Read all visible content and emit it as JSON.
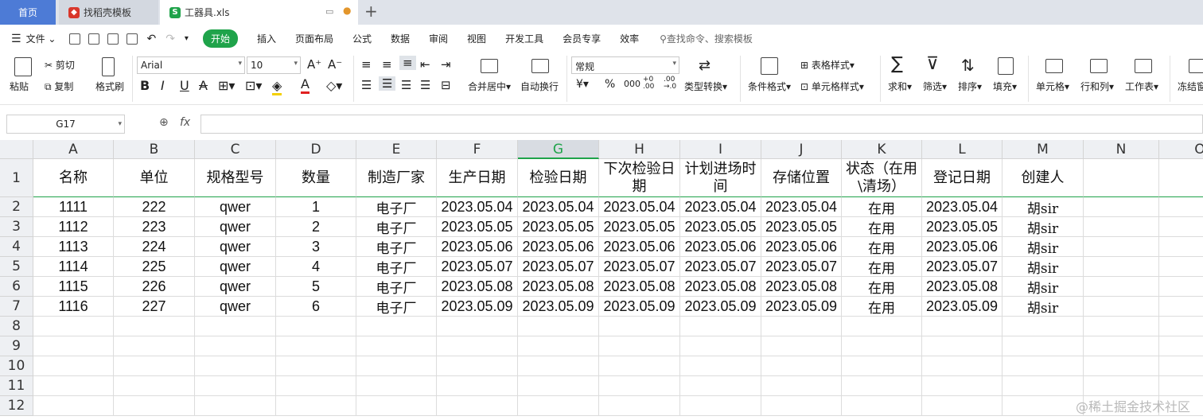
{
  "tabs": {
    "home": "首页",
    "template": "找稻壳模板",
    "file": "工器具.xls"
  },
  "menu": {
    "file": "文件",
    "items": [
      "开始",
      "插入",
      "页面布局",
      "公式",
      "数据",
      "审阅",
      "视图",
      "开发工具",
      "会员专享",
      "效率"
    ],
    "search": "查找命令、搜索模板"
  },
  "ribbon": {
    "paste": "粘贴",
    "cut": "剪切",
    "copy": "复制",
    "format_painter": "格式刷",
    "font_name": "Arial",
    "font_size": "10",
    "merge_center": "合并居中",
    "wrap": "自动换行",
    "number_format": "常规",
    "type_convert": "类型转换",
    "cond_format": "条件格式",
    "table_style": "表格样式",
    "cell_style": "单元格样式",
    "sum": "求和",
    "filter": "筛选",
    "sort": "排序",
    "fill": "填充",
    "cell": "单元格",
    "row_col": "行和列",
    "worksheet": "工作表",
    "freeze": "冻结窗"
  },
  "formula_bar": {
    "name_box": "G17",
    "fx": "fx",
    "value": ""
  },
  "sheet": {
    "columns": [
      "A",
      "B",
      "C",
      "D",
      "E",
      "F",
      "G",
      "H",
      "I",
      "J",
      "K",
      "L",
      "M",
      "N",
      "O"
    ],
    "rows": [
      "1",
      "2",
      "3",
      "4",
      "5",
      "6",
      "7",
      "8",
      "9",
      "10",
      "11",
      "12"
    ],
    "headers": [
      "名称",
      "单位",
      "规格型号",
      "数量",
      "制造厂家",
      "生产日期",
      "检验日期",
      "下次检验日期",
      "计划进场时间",
      "存储位置",
      "状态（在用\\清场）",
      "登记日期",
      "创建人"
    ],
    "data": [
      [
        "1111",
        "222",
        "qwer",
        "1",
        "电子厂",
        "2023.05.04",
        "2023.05.04",
        "2023.05.04",
        "2023.05.04",
        "2023.05.04",
        "在用",
        "2023.05.04",
        "胡sir"
      ],
      [
        "1112",
        "223",
        "qwer",
        "2",
        "电子厂",
        "2023.05.05",
        "2023.05.05",
        "2023.05.05",
        "2023.05.05",
        "2023.05.05",
        "在用",
        "2023.05.05",
        "胡sir"
      ],
      [
        "1113",
        "224",
        "qwer",
        "3",
        "电子厂",
        "2023.05.06",
        "2023.05.06",
        "2023.05.06",
        "2023.05.06",
        "2023.05.06",
        "在用",
        "2023.05.06",
        "胡sir"
      ],
      [
        "1114",
        "225",
        "qwer",
        "4",
        "电子厂",
        "2023.05.07",
        "2023.05.07",
        "2023.05.07",
        "2023.05.07",
        "2023.05.07",
        "在用",
        "2023.05.07",
        "胡sir"
      ],
      [
        "1115",
        "226",
        "qwer",
        "5",
        "电子厂",
        "2023.05.08",
        "2023.05.08",
        "2023.05.08",
        "2023.05.08",
        "2023.05.08",
        "在用",
        "2023.05.08",
        "胡sir"
      ],
      [
        "1116",
        "227",
        "qwer",
        "6",
        "电子厂",
        "2023.05.09",
        "2023.05.09",
        "2023.05.09",
        "2023.05.09",
        "2023.05.09",
        "在用",
        "2023.05.09",
        "胡sir"
      ]
    ],
    "active_column": "G"
  },
  "watermark": "@稀土掘金技术社区",
  "colors": {
    "accent": "#1fa34a",
    "home_tab": "#4d7bd6"
  }
}
